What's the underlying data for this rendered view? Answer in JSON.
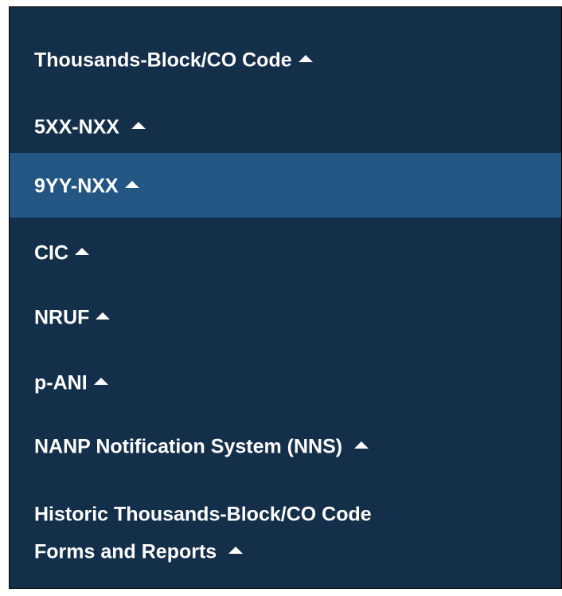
{
  "menu": {
    "items": [
      {
        "label": "Thousands-Block/CO Code",
        "active": false
      },
      {
        "label": "5XX-NXX",
        "active": false
      },
      {
        "label": "9YY-NXX",
        "active": true
      },
      {
        "label": "CIC",
        "active": false
      },
      {
        "label": "NRUF",
        "active": false
      },
      {
        "label": "p-ANI",
        "active": false
      },
      {
        "label": "NANP Notification System (NNS)",
        "active": false
      },
      {
        "label_line1": "Historic Thousands-Block/CO Code",
        "label_line2": "Forms and Reports",
        "active": false
      }
    ]
  },
  "icons": {
    "expand": "caret-up-icon"
  },
  "colors": {
    "background": "#142f4a",
    "active_background": "#245683",
    "text": "#ffffff"
  }
}
